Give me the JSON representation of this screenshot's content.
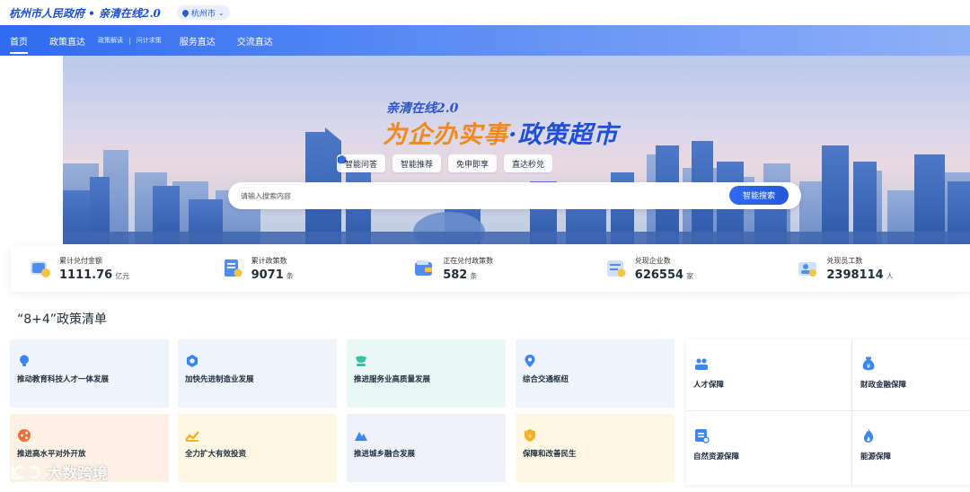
{
  "header": {
    "brand": "杭州市人民政府 • 亲清在线2.0",
    "city": "杭州市"
  },
  "nav": {
    "items": [
      "首页",
      "政策直达",
      "政策解读",
      "问计求策",
      "服务直达",
      "交流直达"
    ]
  },
  "banner": {
    "subtitle": "亲清在线2.0",
    "title_part1": "为企办实事",
    "title_dot": "·",
    "title_part2": "政策超市",
    "quick_buttons": [
      "智能问答",
      "智能推荐",
      "免申即享",
      "直达秒兑"
    ],
    "search_placeholder": "请输入搜索内容",
    "search_button": "智能搜索"
  },
  "stats": [
    {
      "label": "累计兑付金额",
      "value": "1111.76",
      "unit": "亿元",
      "icon": "coins-icon"
    },
    {
      "label": "累计政策数",
      "value": "9071",
      "unit": "条",
      "icon": "policy-doc-icon"
    },
    {
      "label": "正在兑付政策数",
      "value": "582",
      "unit": "条",
      "icon": "wallet-icon"
    },
    {
      "label": "兑现企业数",
      "value": "626554",
      "unit": "家",
      "icon": "enterprise-icon"
    },
    {
      "label": "兑现员工数",
      "value": "2398114",
      "unit": "人",
      "icon": "staff-icon"
    }
  ],
  "section": {
    "title": "“8+4”政策清单"
  },
  "cards": [
    {
      "label": "推动教育科技人才一体发展",
      "icon": "bulb-icon"
    },
    {
      "label": "加快先进制造业发展",
      "icon": "gear-icon"
    },
    {
      "label": "推进服务业高质量发展",
      "icon": "service-icon"
    },
    {
      "label": "综合交通枢纽",
      "icon": "location-icon"
    },
    {
      "label": "推进高水平对外开放",
      "icon": "share-icon"
    },
    {
      "label": "全力扩大有效投资",
      "icon": "trend-icon"
    },
    {
      "label": "推进城乡融合发展",
      "icon": "mountain-icon"
    },
    {
      "label": "保障和改善民生",
      "icon": "shield-icon"
    }
  ],
  "guarantees": [
    {
      "label": "人才保障",
      "icon": "people-icon"
    },
    {
      "label": "财政金融保障",
      "icon": "money-bag-icon"
    },
    {
      "label": "自然资源保障",
      "icon": "resource-doc-icon"
    },
    {
      "label": "能源保障",
      "icon": "flame-icon"
    }
  ],
  "watermark": {
    "text": "大数跨境"
  },
  "colors": {
    "primary": "#2f6bf0",
    "accent_orange": "#f08a20"
  }
}
